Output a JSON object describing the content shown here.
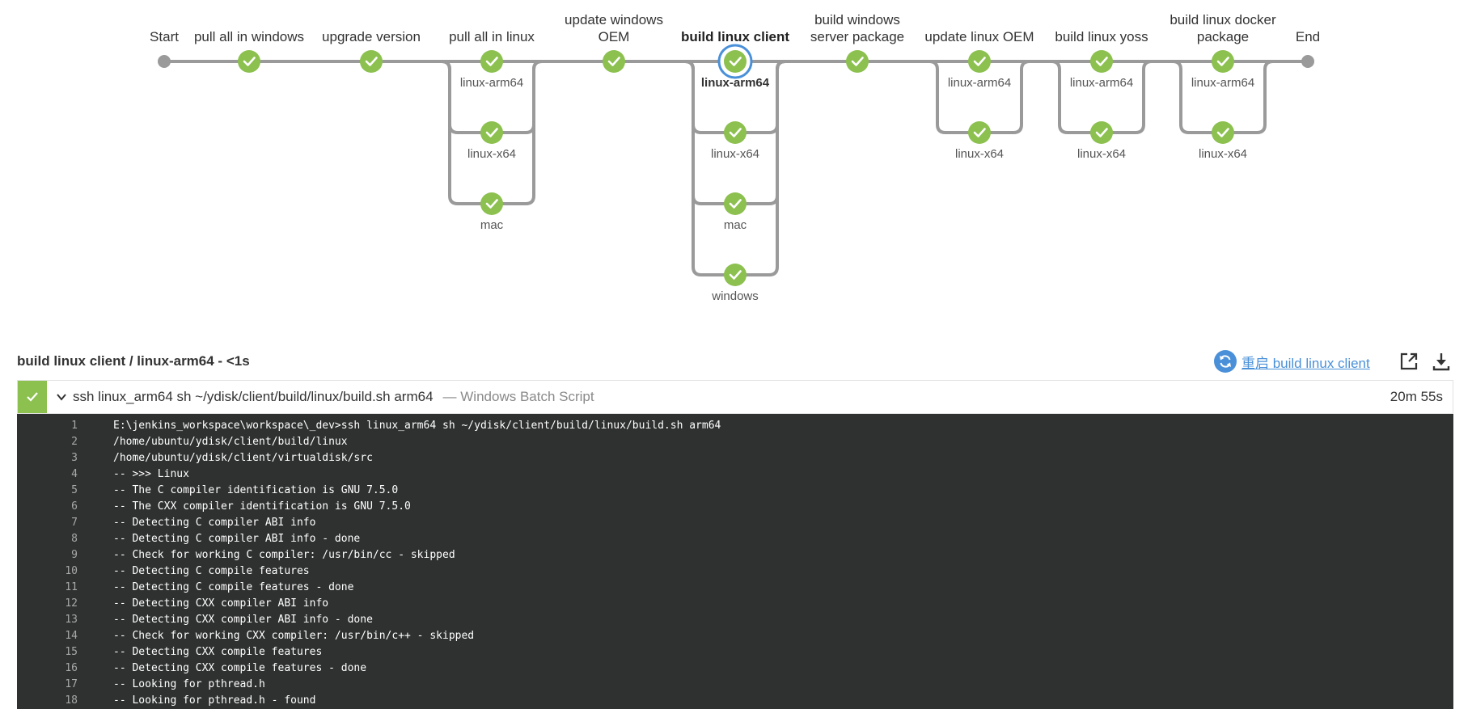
{
  "stages": [
    {
      "label_lines": [
        "Start"
      ]
    },
    {
      "label_lines": [
        "pull all in windows"
      ]
    },
    {
      "label_lines": [
        "upgrade version"
      ]
    },
    {
      "label_lines": [
        "pull all in linux"
      ],
      "branches": [
        "linux-arm64",
        "linux-x64",
        "mac"
      ]
    },
    {
      "label_lines": [
        "update windows",
        "OEM"
      ]
    },
    {
      "label_lines": [
        "build linux client"
      ],
      "branches": [
        "linux-arm64",
        "linux-x64",
        "mac",
        "windows"
      ],
      "selected": true,
      "selected_branch": "linux-arm64"
    },
    {
      "label_lines": [
        "build windows",
        "server package"
      ]
    },
    {
      "label_lines": [
        "update linux OEM"
      ],
      "branches": [
        "linux-arm64",
        "linux-x64"
      ]
    },
    {
      "label_lines": [
        "build linux yoss"
      ],
      "branches": [
        "linux-arm64",
        "linux-x64"
      ]
    },
    {
      "label_lines": [
        "build linux docker",
        "package"
      ],
      "branches": [
        "linux-arm64",
        "linux-x64"
      ]
    },
    {
      "label_lines": [
        "End"
      ]
    }
  ],
  "colors": {
    "success": "#8cc04f",
    "track": "#9a9a9a",
    "accent": "#4a90d9",
    "log_bg": "#2f3030"
  },
  "step": {
    "title": "build linux client / linux-arm64 - <1s",
    "restart_label": "重启 build linux client",
    "restart_icon": "restart-icon",
    "open_icon": "external-link-icon",
    "download_icon": "download-icon",
    "status_icon": "check-icon",
    "command": "ssh linux_arm64 sh ~/ydisk/client/build/linux/build.sh arm64",
    "type": "— Windows Batch Script",
    "duration": "20m 55s"
  },
  "log_lines": [
    {
      "num": "1",
      "text": "E:\\jenkins_workspace\\workspace\\_dev>ssh linux_arm64 sh ~/ydisk/client/build/linux/build.sh arm64"
    },
    {
      "num": "2",
      "text": "/home/ubuntu/ydisk/client/build/linux"
    },
    {
      "num": "3",
      "text": "/home/ubuntu/ydisk/client/virtualdisk/src"
    },
    {
      "num": "4",
      "text": "-- >>> Linux"
    },
    {
      "num": "5",
      "text": "-- The C compiler identification is GNU 7.5.0"
    },
    {
      "num": "6",
      "text": "-- The CXX compiler identification is GNU 7.5.0"
    },
    {
      "num": "7",
      "text": "-- Detecting C compiler ABI info"
    },
    {
      "num": "8",
      "text": "-- Detecting C compiler ABI info - done"
    },
    {
      "num": "9",
      "text": "-- Check for working C compiler: /usr/bin/cc - skipped"
    },
    {
      "num": "10",
      "text": "-- Detecting C compile features"
    },
    {
      "num": "11",
      "text": "-- Detecting C compile features - done"
    },
    {
      "num": "12",
      "text": "-- Detecting CXX compiler ABI info"
    },
    {
      "num": "13",
      "text": "-- Detecting CXX compiler ABI info - done"
    },
    {
      "num": "14",
      "text": "-- Check for working CXX compiler: /usr/bin/c++ - skipped"
    },
    {
      "num": "15",
      "text": "-- Detecting CXX compile features"
    },
    {
      "num": "16",
      "text": "-- Detecting CXX compile features - done"
    },
    {
      "num": "17",
      "text": "-- Looking for pthread.h"
    },
    {
      "num": "18",
      "text": "-- Looking for pthread.h - found"
    }
  ]
}
